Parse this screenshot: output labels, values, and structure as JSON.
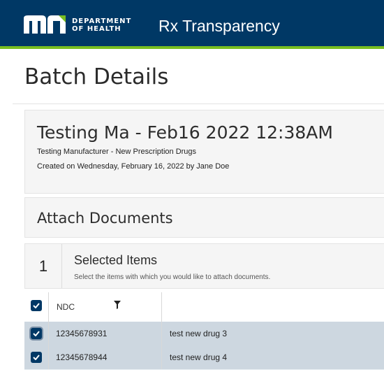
{
  "header": {
    "logo_text_line1": "DEPARTMENT",
    "logo_text_line2": "OF HEALTH",
    "app_title": "Rx Transparency"
  },
  "page_title": "Batch Details",
  "batch": {
    "name": "Testing Ma - Feb16 2022 12:38AM",
    "subtitle": "Testing Manufacturer - New Prescription Drugs",
    "created": "Created on Wednesday, February 16, 2022 by Jane Doe"
  },
  "attach": {
    "title": "Attach Documents"
  },
  "selection": {
    "count": "1",
    "title": "Selected Items",
    "subtitle": "Select the items with which you would like to attach documents."
  },
  "table": {
    "columns": [
      "NDC"
    ],
    "rows": [
      {
        "ndc": "12345678931",
        "name": "test new drug 3",
        "checked": true
      },
      {
        "ndc": "12345678944",
        "name": "test new drug 4",
        "checked": true
      }
    ]
  },
  "colors": {
    "header_bg": "#003865",
    "header_accent": "#78be20",
    "selected_row": "#cdd7e0"
  }
}
